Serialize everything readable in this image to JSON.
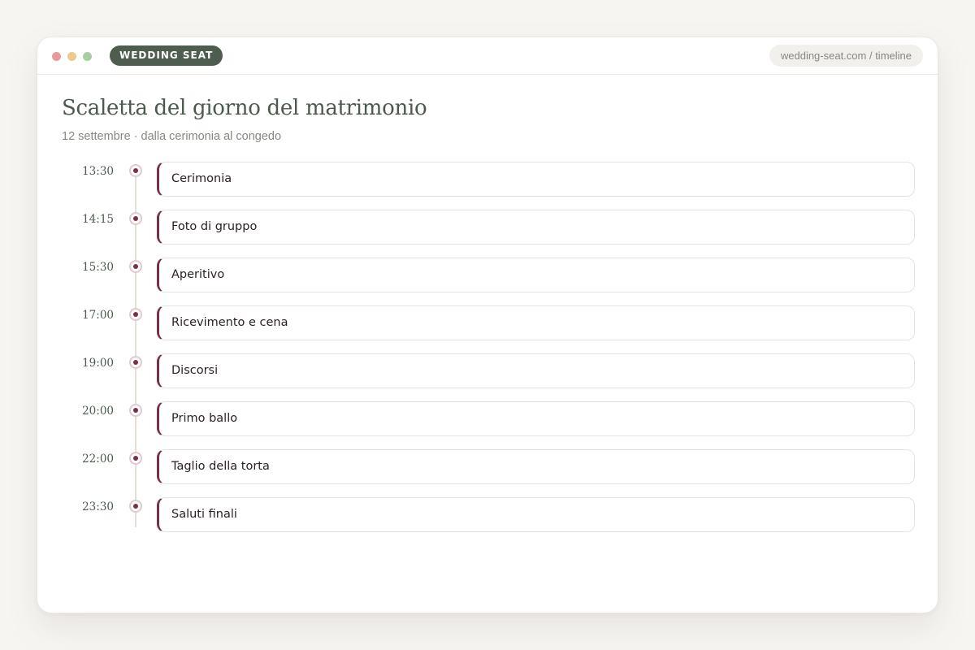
{
  "window": {
    "dots": [
      {
        "name": "close",
        "color": "#e79a9a"
      },
      {
        "name": "minimize",
        "color": "#edc98b"
      },
      {
        "name": "maximize",
        "color": "#a8cfa2"
      }
    ],
    "brand": "WEDDING SEAT",
    "brand_color": "#4d5e4f",
    "url": "wedding-seat.com / timeline"
  },
  "page": {
    "title": "Scaletta del giorno del matrimonio",
    "subtitle": "12 settembre · dalla cerimonia al congedo"
  },
  "accent_color": "#7a2f48",
  "events": [
    {
      "time": "13:30",
      "label": "Cerimonia"
    },
    {
      "time": "14:15",
      "label": "Foto di gruppo"
    },
    {
      "time": "15:30",
      "label": "Aperitivo"
    },
    {
      "time": "17:00",
      "label": "Ricevimento e cena"
    },
    {
      "time": "19:00",
      "label": "Discorsi"
    },
    {
      "time": "20:00",
      "label": "Primo ballo"
    },
    {
      "time": "22:00",
      "label": "Taglio della torta"
    },
    {
      "time": "23:30",
      "label": "Saluti finali"
    }
  ]
}
